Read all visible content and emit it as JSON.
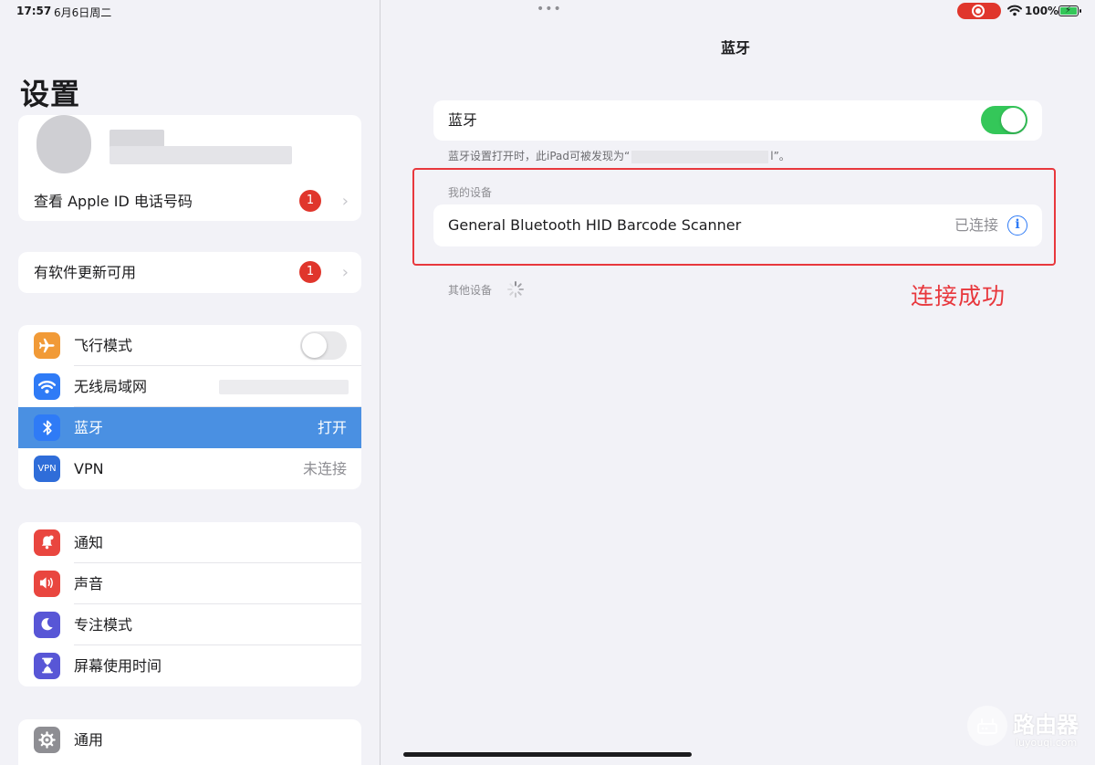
{
  "status_bar": {
    "time": "17:57",
    "date": "6月6日周二",
    "dots": "•••",
    "battery_percent": "100%"
  },
  "sidebar": {
    "title": "设置",
    "apple_id": {
      "label": "查看 Apple ID 电话号码",
      "badge": "1"
    },
    "software_update": {
      "label": "有软件更新可用",
      "badge": "1"
    },
    "connectivity": [
      {
        "label": "飞行模式",
        "icon": "airplane-icon",
        "color": "#f19a37",
        "toggle": "off"
      },
      {
        "label": "无线局域网",
        "icon": "wifi-icon",
        "color": "#2f7bf6"
      },
      {
        "label": "蓝牙",
        "icon": "bluetooth-icon",
        "color": "#2f7bf6",
        "value": "打开",
        "selected": true
      },
      {
        "label": "VPN",
        "icon": "vpn-icon",
        "color": "#2f6dd9",
        "value": "未连接",
        "icon_text": "VPN"
      }
    ],
    "notifications": [
      {
        "label": "通知",
        "icon": "bell-icon",
        "color": "#e9463f"
      },
      {
        "label": "声音",
        "icon": "speaker-icon",
        "color": "#e9463f"
      },
      {
        "label": "专注模式",
        "icon": "moon-icon",
        "color": "#5856d6"
      },
      {
        "label": "屏幕使用时间",
        "icon": "hourglass-icon",
        "color": "#5856d6"
      }
    ],
    "general": [
      {
        "label": "通用",
        "icon": "gear-icon",
        "color": "#8e8e93"
      }
    ]
  },
  "detail": {
    "title": "蓝牙",
    "bluetooth_toggle_label": "蓝牙",
    "bluetooth_on": true,
    "discoverable_prefix": "蓝牙设置打开时，此iPad可被发现为“",
    "discoverable_suffix": "l”。",
    "my_devices_header": "我的设备",
    "device_name": "General Bluetooth HID Barcode Scanner",
    "device_status": "已连接",
    "info_glyph": "i",
    "other_devices_header": "其他设备",
    "annotation": "连接成功"
  },
  "watermark": {
    "text": "路由器",
    "url": "luyouqi.com"
  },
  "colors": {
    "accent_blue": "#2f7bf6",
    "selected_row": "#4a90e2",
    "toggle_on": "#34c759",
    "badge_red": "#e0362c",
    "annotation_red": "#e8383d"
  }
}
